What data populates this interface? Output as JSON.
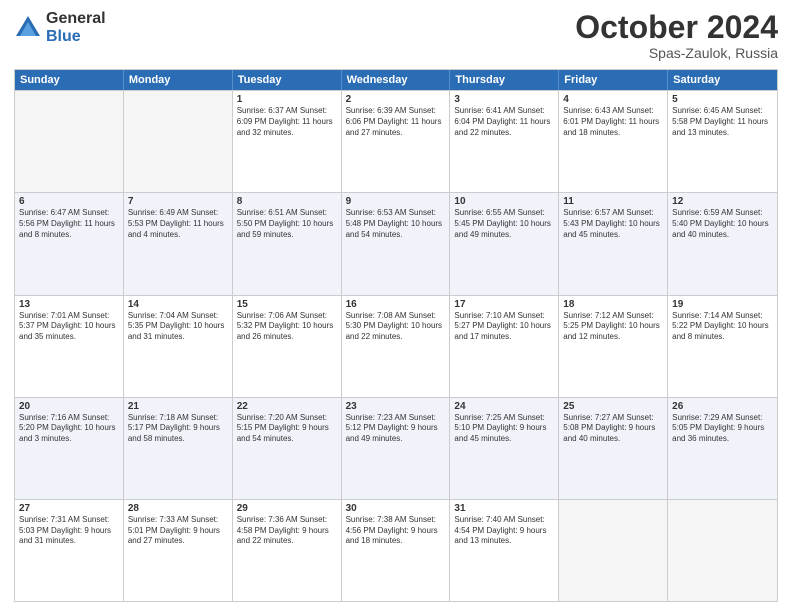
{
  "logo": {
    "general": "General",
    "blue": "Blue"
  },
  "title": "October 2024",
  "subtitle": "Spas-Zaulok, Russia",
  "days": [
    "Sunday",
    "Monday",
    "Tuesday",
    "Wednesday",
    "Thursday",
    "Friday",
    "Saturday"
  ],
  "rows": [
    [
      {
        "day": "",
        "text": ""
      },
      {
        "day": "",
        "text": ""
      },
      {
        "day": "1",
        "text": "Sunrise: 6:37 AM\nSunset: 6:09 PM\nDaylight: 11 hours and 32 minutes."
      },
      {
        "day": "2",
        "text": "Sunrise: 6:39 AM\nSunset: 6:06 PM\nDaylight: 11 hours and 27 minutes."
      },
      {
        "day": "3",
        "text": "Sunrise: 6:41 AM\nSunset: 6:04 PM\nDaylight: 11 hours and 22 minutes."
      },
      {
        "day": "4",
        "text": "Sunrise: 6:43 AM\nSunset: 6:01 PM\nDaylight: 11 hours and 18 minutes."
      },
      {
        "day": "5",
        "text": "Sunrise: 6:45 AM\nSunset: 5:58 PM\nDaylight: 11 hours and 13 minutes."
      }
    ],
    [
      {
        "day": "6",
        "text": "Sunrise: 6:47 AM\nSunset: 5:56 PM\nDaylight: 11 hours and 8 minutes."
      },
      {
        "day": "7",
        "text": "Sunrise: 6:49 AM\nSunset: 5:53 PM\nDaylight: 11 hours and 4 minutes."
      },
      {
        "day": "8",
        "text": "Sunrise: 6:51 AM\nSunset: 5:50 PM\nDaylight: 10 hours and 59 minutes."
      },
      {
        "day": "9",
        "text": "Sunrise: 6:53 AM\nSunset: 5:48 PM\nDaylight: 10 hours and 54 minutes."
      },
      {
        "day": "10",
        "text": "Sunrise: 6:55 AM\nSunset: 5:45 PM\nDaylight: 10 hours and 49 minutes."
      },
      {
        "day": "11",
        "text": "Sunrise: 6:57 AM\nSunset: 5:43 PM\nDaylight: 10 hours and 45 minutes."
      },
      {
        "day": "12",
        "text": "Sunrise: 6:59 AM\nSunset: 5:40 PM\nDaylight: 10 hours and 40 minutes."
      }
    ],
    [
      {
        "day": "13",
        "text": "Sunrise: 7:01 AM\nSunset: 5:37 PM\nDaylight: 10 hours and 35 minutes."
      },
      {
        "day": "14",
        "text": "Sunrise: 7:04 AM\nSunset: 5:35 PM\nDaylight: 10 hours and 31 minutes."
      },
      {
        "day": "15",
        "text": "Sunrise: 7:06 AM\nSunset: 5:32 PM\nDaylight: 10 hours and 26 minutes."
      },
      {
        "day": "16",
        "text": "Sunrise: 7:08 AM\nSunset: 5:30 PM\nDaylight: 10 hours and 22 minutes."
      },
      {
        "day": "17",
        "text": "Sunrise: 7:10 AM\nSunset: 5:27 PM\nDaylight: 10 hours and 17 minutes."
      },
      {
        "day": "18",
        "text": "Sunrise: 7:12 AM\nSunset: 5:25 PM\nDaylight: 10 hours and 12 minutes."
      },
      {
        "day": "19",
        "text": "Sunrise: 7:14 AM\nSunset: 5:22 PM\nDaylight: 10 hours and 8 minutes."
      }
    ],
    [
      {
        "day": "20",
        "text": "Sunrise: 7:16 AM\nSunset: 5:20 PM\nDaylight: 10 hours and 3 minutes."
      },
      {
        "day": "21",
        "text": "Sunrise: 7:18 AM\nSunset: 5:17 PM\nDaylight: 9 hours and 58 minutes."
      },
      {
        "day": "22",
        "text": "Sunrise: 7:20 AM\nSunset: 5:15 PM\nDaylight: 9 hours and 54 minutes."
      },
      {
        "day": "23",
        "text": "Sunrise: 7:23 AM\nSunset: 5:12 PM\nDaylight: 9 hours and 49 minutes."
      },
      {
        "day": "24",
        "text": "Sunrise: 7:25 AM\nSunset: 5:10 PM\nDaylight: 9 hours and 45 minutes."
      },
      {
        "day": "25",
        "text": "Sunrise: 7:27 AM\nSunset: 5:08 PM\nDaylight: 9 hours and 40 minutes."
      },
      {
        "day": "26",
        "text": "Sunrise: 7:29 AM\nSunset: 5:05 PM\nDaylight: 9 hours and 36 minutes."
      }
    ],
    [
      {
        "day": "27",
        "text": "Sunrise: 7:31 AM\nSunset: 5:03 PM\nDaylight: 9 hours and 31 minutes."
      },
      {
        "day": "28",
        "text": "Sunrise: 7:33 AM\nSunset: 5:01 PM\nDaylight: 9 hours and 27 minutes."
      },
      {
        "day": "29",
        "text": "Sunrise: 7:36 AM\nSunset: 4:58 PM\nDaylight: 9 hours and 22 minutes."
      },
      {
        "day": "30",
        "text": "Sunrise: 7:38 AM\nSunset: 4:56 PM\nDaylight: 9 hours and 18 minutes."
      },
      {
        "day": "31",
        "text": "Sunrise: 7:40 AM\nSunset: 4:54 PM\nDaylight: 9 hours and 13 minutes."
      },
      {
        "day": "",
        "text": ""
      },
      {
        "day": "",
        "text": ""
      }
    ]
  ]
}
